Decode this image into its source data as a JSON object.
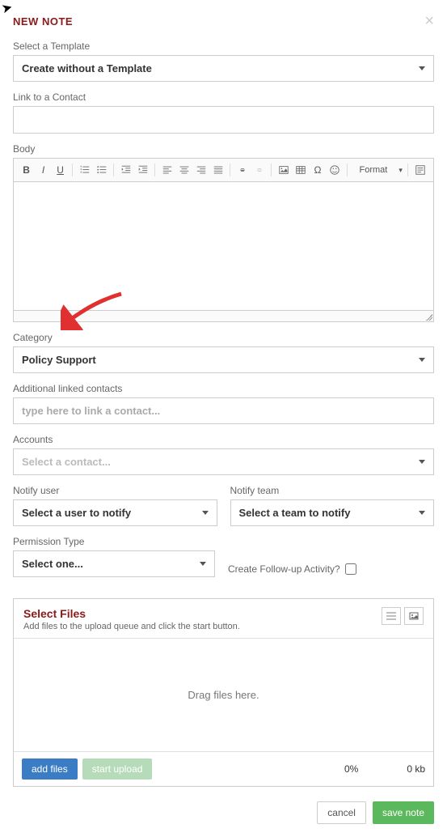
{
  "header": {
    "title": "NEW NOTE"
  },
  "template": {
    "label": "Select a Template",
    "value": "Create without a Template"
  },
  "link_contact": {
    "label": "Link to a Contact",
    "value": ""
  },
  "body": {
    "label": "Body",
    "format_label": "Format"
  },
  "category": {
    "label": "Category",
    "value": "Policy Support"
  },
  "additional_contacts": {
    "label": "Additional linked contacts",
    "placeholder": "type here to link a contact..."
  },
  "accounts": {
    "label": "Accounts",
    "placeholder": "Select a contact..."
  },
  "notify_user": {
    "label": "Notify user",
    "placeholder": "Select a user to notify"
  },
  "notify_team": {
    "label": "Notify team",
    "placeholder": "Select a team to notify"
  },
  "permission": {
    "label": "Permission Type",
    "placeholder": "Select one..."
  },
  "followup": {
    "label": "Create Follow-up Activity?"
  },
  "upload": {
    "title": "Select Files",
    "subtitle": "Add files to the upload queue and click the start button.",
    "drop_text": "Drag files here.",
    "add_btn": "add files",
    "start_btn": "start upload",
    "percent": "0%",
    "size": "0 kb"
  },
  "footer": {
    "cancel": "cancel",
    "save": "save note"
  }
}
